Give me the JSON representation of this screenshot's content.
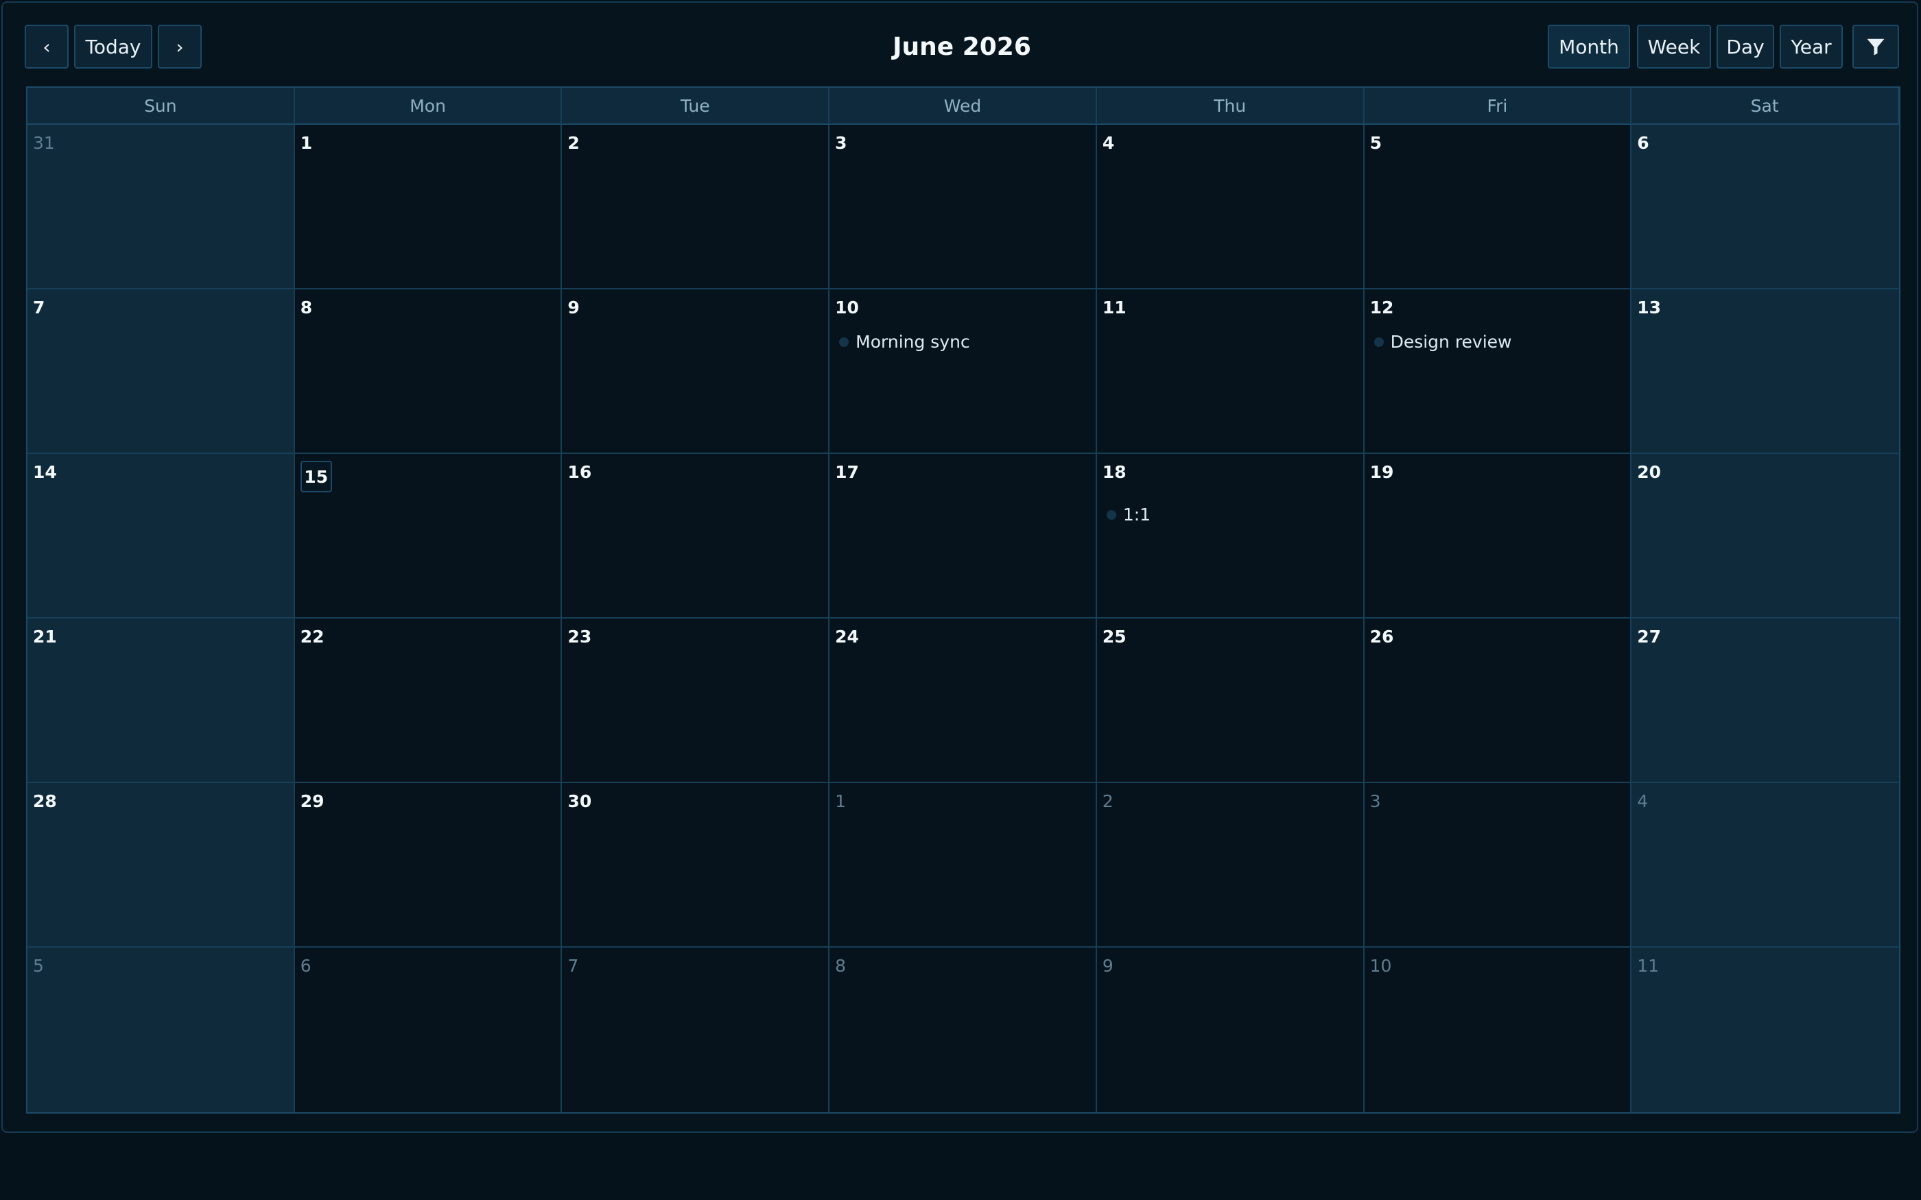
{
  "toolbar": {
    "prev_label": "‹",
    "today_label": "Today",
    "next_label": "›",
    "title": "June 2026",
    "views": [
      "Month",
      "Week",
      "Day",
      "Year"
    ],
    "active_view": "Month",
    "filter_icon": "filter-icon"
  },
  "weekdays": [
    "Sun",
    "Mon",
    "Tue",
    "Wed",
    "Thu",
    "Fri",
    "Sat"
  ],
  "weeks": [
    [
      {
        "day": "31",
        "other": true
      },
      {
        "day": "1"
      },
      {
        "day": "2"
      },
      {
        "day": "3"
      },
      {
        "day": "4"
      },
      {
        "day": "5"
      },
      {
        "day": "6"
      }
    ],
    [
      {
        "day": "7"
      },
      {
        "day": "8"
      },
      {
        "day": "9"
      },
      {
        "day": "10",
        "events": [
          "Morning sync"
        ]
      },
      {
        "day": "11"
      },
      {
        "day": "12",
        "events": [
          "Design review"
        ]
      },
      {
        "day": "13"
      }
    ],
    [
      {
        "day": "14"
      },
      {
        "day": "15",
        "today": true
      },
      {
        "day": "16"
      },
      {
        "day": "17"
      },
      {
        "day": "18",
        "events": [
          "1:1"
        ]
      },
      {
        "day": "19"
      },
      {
        "day": "20"
      }
    ],
    [
      {
        "day": "21"
      },
      {
        "day": "22"
      },
      {
        "day": "23"
      },
      {
        "day": "24"
      },
      {
        "day": "25"
      },
      {
        "day": "26"
      },
      {
        "day": "27"
      }
    ],
    [
      {
        "day": "28"
      },
      {
        "day": "29"
      },
      {
        "day": "30"
      },
      {
        "day": "1",
        "other": true
      },
      {
        "day": "2",
        "other": true
      },
      {
        "day": "3",
        "other": true
      },
      {
        "day": "4",
        "other": true
      }
    ],
    [
      {
        "day": "5",
        "other": true
      },
      {
        "day": "6",
        "other": true
      },
      {
        "day": "7",
        "other": true
      },
      {
        "day": "8",
        "other": true
      },
      {
        "day": "9",
        "other": true
      },
      {
        "day": "10",
        "other": true
      },
      {
        "day": "11",
        "other": true
      }
    ]
  ],
  "colors": {
    "background": "#06141e",
    "weekend_cell": "#0e2a3b",
    "border": "#1b4a66",
    "event_dot": "#153449"
  }
}
